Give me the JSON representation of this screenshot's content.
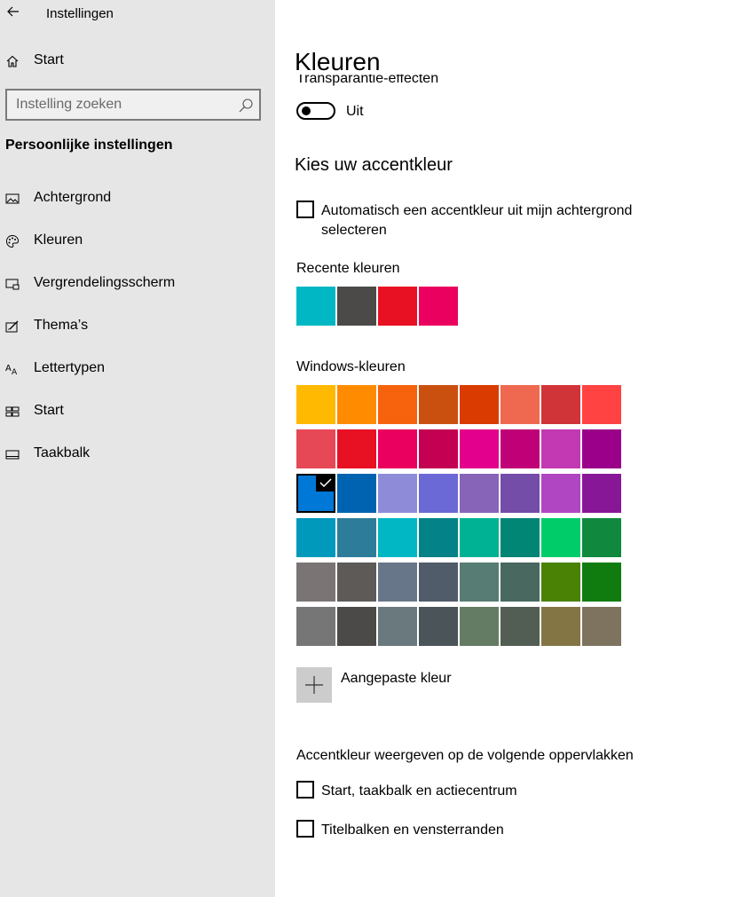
{
  "app": {
    "title": "Instellingen"
  },
  "sidebar": {
    "home_label": "Start",
    "search_placeholder": "Instelling zoeken",
    "section_title": "Persoonlijke instellingen",
    "items": [
      {
        "label": "Achtergrond",
        "icon": "picture-icon"
      },
      {
        "label": "Kleuren",
        "icon": "palette-icon"
      },
      {
        "label": "Vergrendelingsscherm",
        "icon": "lock-screen-icon"
      },
      {
        "label": "Thema’s",
        "icon": "theme-brush-icon"
      },
      {
        "label": "Lettertypen",
        "icon": "font-icon"
      },
      {
        "label": "Start",
        "icon": "start-tiles-icon"
      },
      {
        "label": "Taakbalk",
        "icon": "taskbar-icon"
      }
    ]
  },
  "main": {
    "title": "Kleuren",
    "transparency_label": "Transparantie-effecten",
    "transparency_state": "Uit",
    "accent_heading": "Kies uw accentkleur",
    "auto_accent": {
      "line1": "Automatisch een accentkleur uit mijn achtergrond",
      "line2": "selecteren",
      "checked": false
    },
    "recent_label": "Recente kleuren",
    "recent_colors": [
      "#00B7C3",
      "#4C4A48",
      "#E81123",
      "#EA005E"
    ],
    "windows_label": "Windows-kleuren",
    "windows_colors": [
      [
        "#FFB900",
        "#FF8C00",
        "#F7630C",
        "#CA5010",
        "#DA3B01",
        "#EF6950",
        "#D13438",
        "#FF4343"
      ],
      [
        "#E74856",
        "#E81123",
        "#EA005E",
        "#C30052",
        "#E3008C",
        "#BF0077",
        "#C239B3",
        "#9A0089"
      ],
      [
        "#0078D7",
        "#0063B1",
        "#8E8CD8",
        "#6B69D6",
        "#8764B8",
        "#744DA9",
        "#B146C2",
        "#881798"
      ],
      [
        "#0099BC",
        "#2D7D9A",
        "#00B7C3",
        "#038387",
        "#00B294",
        "#018574",
        "#00CC6A",
        "#10893E"
      ],
      [
        "#7A7574",
        "#5D5A58",
        "#68768A",
        "#515C6B",
        "#567C73",
        "#486860",
        "#498205",
        "#107C10"
      ],
      [
        "#767676",
        "#4C4A48",
        "#69797E",
        "#4A5459",
        "#647C64",
        "#525E54",
        "#847545",
        "#7E735F"
      ]
    ],
    "selected_color": "#0078D7",
    "custom_color_label": "Aangepaste kleur",
    "surfaces_label": "Accentkleur weergeven op de volgende oppervlakken",
    "surface_options": [
      {
        "label": "Start, taakbalk en actiecentrum",
        "checked": false
      },
      {
        "label": "Titelbalken en vensterranden",
        "checked": false
      }
    ]
  }
}
